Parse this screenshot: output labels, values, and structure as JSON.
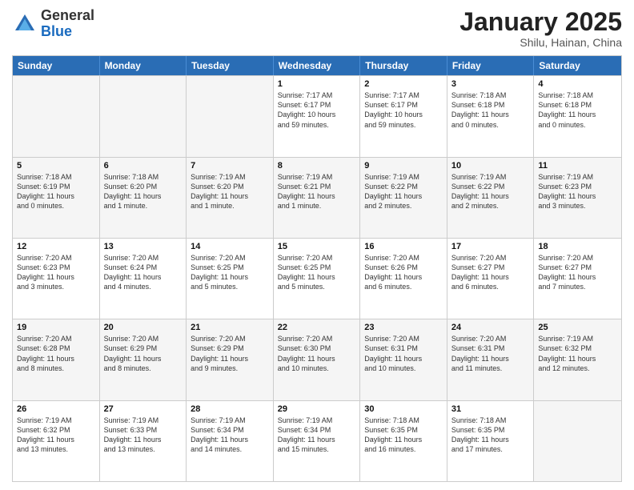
{
  "header": {
    "logo_general": "General",
    "logo_blue": "Blue",
    "month_title": "January 2025",
    "subtitle": "Shilu, Hainan, China"
  },
  "weekdays": [
    "Sunday",
    "Monday",
    "Tuesday",
    "Wednesday",
    "Thursday",
    "Friday",
    "Saturday"
  ],
  "rows": [
    [
      {
        "day": "",
        "info": ""
      },
      {
        "day": "",
        "info": ""
      },
      {
        "day": "",
        "info": ""
      },
      {
        "day": "1",
        "info": "Sunrise: 7:17 AM\nSunset: 6:17 PM\nDaylight: 10 hours\nand 59 minutes."
      },
      {
        "day": "2",
        "info": "Sunrise: 7:17 AM\nSunset: 6:17 PM\nDaylight: 10 hours\nand 59 minutes."
      },
      {
        "day": "3",
        "info": "Sunrise: 7:18 AM\nSunset: 6:18 PM\nDaylight: 11 hours\nand 0 minutes."
      },
      {
        "day": "4",
        "info": "Sunrise: 7:18 AM\nSunset: 6:18 PM\nDaylight: 11 hours\nand 0 minutes."
      }
    ],
    [
      {
        "day": "5",
        "info": "Sunrise: 7:18 AM\nSunset: 6:19 PM\nDaylight: 11 hours\nand 0 minutes."
      },
      {
        "day": "6",
        "info": "Sunrise: 7:18 AM\nSunset: 6:20 PM\nDaylight: 11 hours\nand 1 minute."
      },
      {
        "day": "7",
        "info": "Sunrise: 7:19 AM\nSunset: 6:20 PM\nDaylight: 11 hours\nand 1 minute."
      },
      {
        "day": "8",
        "info": "Sunrise: 7:19 AM\nSunset: 6:21 PM\nDaylight: 11 hours\nand 1 minute."
      },
      {
        "day": "9",
        "info": "Sunrise: 7:19 AM\nSunset: 6:22 PM\nDaylight: 11 hours\nand 2 minutes."
      },
      {
        "day": "10",
        "info": "Sunrise: 7:19 AM\nSunset: 6:22 PM\nDaylight: 11 hours\nand 2 minutes."
      },
      {
        "day": "11",
        "info": "Sunrise: 7:19 AM\nSunset: 6:23 PM\nDaylight: 11 hours\nand 3 minutes."
      }
    ],
    [
      {
        "day": "12",
        "info": "Sunrise: 7:20 AM\nSunset: 6:23 PM\nDaylight: 11 hours\nand 3 minutes."
      },
      {
        "day": "13",
        "info": "Sunrise: 7:20 AM\nSunset: 6:24 PM\nDaylight: 11 hours\nand 4 minutes."
      },
      {
        "day": "14",
        "info": "Sunrise: 7:20 AM\nSunset: 6:25 PM\nDaylight: 11 hours\nand 5 minutes."
      },
      {
        "day": "15",
        "info": "Sunrise: 7:20 AM\nSunset: 6:25 PM\nDaylight: 11 hours\nand 5 minutes."
      },
      {
        "day": "16",
        "info": "Sunrise: 7:20 AM\nSunset: 6:26 PM\nDaylight: 11 hours\nand 6 minutes."
      },
      {
        "day": "17",
        "info": "Sunrise: 7:20 AM\nSunset: 6:27 PM\nDaylight: 11 hours\nand 6 minutes."
      },
      {
        "day": "18",
        "info": "Sunrise: 7:20 AM\nSunset: 6:27 PM\nDaylight: 11 hours\nand 7 minutes."
      }
    ],
    [
      {
        "day": "19",
        "info": "Sunrise: 7:20 AM\nSunset: 6:28 PM\nDaylight: 11 hours\nand 8 minutes."
      },
      {
        "day": "20",
        "info": "Sunrise: 7:20 AM\nSunset: 6:29 PM\nDaylight: 11 hours\nand 8 minutes."
      },
      {
        "day": "21",
        "info": "Sunrise: 7:20 AM\nSunset: 6:29 PM\nDaylight: 11 hours\nand 9 minutes."
      },
      {
        "day": "22",
        "info": "Sunrise: 7:20 AM\nSunset: 6:30 PM\nDaylight: 11 hours\nand 10 minutes."
      },
      {
        "day": "23",
        "info": "Sunrise: 7:20 AM\nSunset: 6:31 PM\nDaylight: 11 hours\nand 10 minutes."
      },
      {
        "day": "24",
        "info": "Sunrise: 7:20 AM\nSunset: 6:31 PM\nDaylight: 11 hours\nand 11 minutes."
      },
      {
        "day": "25",
        "info": "Sunrise: 7:19 AM\nSunset: 6:32 PM\nDaylight: 11 hours\nand 12 minutes."
      }
    ],
    [
      {
        "day": "26",
        "info": "Sunrise: 7:19 AM\nSunset: 6:32 PM\nDaylight: 11 hours\nand 13 minutes."
      },
      {
        "day": "27",
        "info": "Sunrise: 7:19 AM\nSunset: 6:33 PM\nDaylight: 11 hours\nand 13 minutes."
      },
      {
        "day": "28",
        "info": "Sunrise: 7:19 AM\nSunset: 6:34 PM\nDaylight: 11 hours\nand 14 minutes."
      },
      {
        "day": "29",
        "info": "Sunrise: 7:19 AM\nSunset: 6:34 PM\nDaylight: 11 hours\nand 15 minutes."
      },
      {
        "day": "30",
        "info": "Sunrise: 7:18 AM\nSunset: 6:35 PM\nDaylight: 11 hours\nand 16 minutes."
      },
      {
        "day": "31",
        "info": "Sunrise: 7:18 AM\nSunset: 6:35 PM\nDaylight: 11 hours\nand 17 minutes."
      },
      {
        "day": "",
        "info": ""
      }
    ]
  ]
}
